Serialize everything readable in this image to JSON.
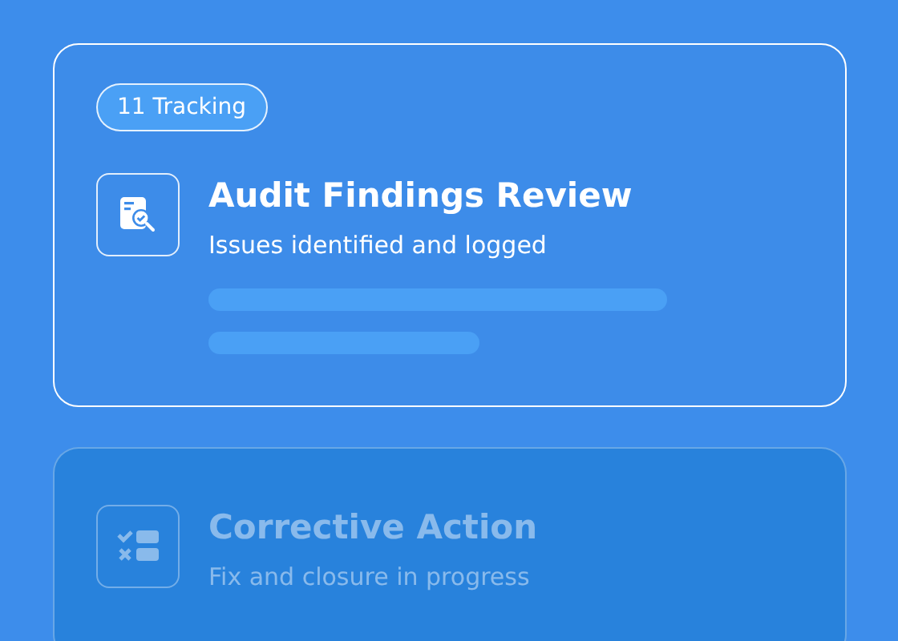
{
  "cards": [
    {
      "badge": "11 Tracking",
      "kind": "document-search",
      "title": "Audit Findings Review",
      "subtitle": "Issues identified and logged",
      "selected": true
    },
    {
      "kind": "checklist",
      "title": "Corrective Action",
      "subtitle": "Fix and closure in progress",
      "selected": false
    }
  ]
}
